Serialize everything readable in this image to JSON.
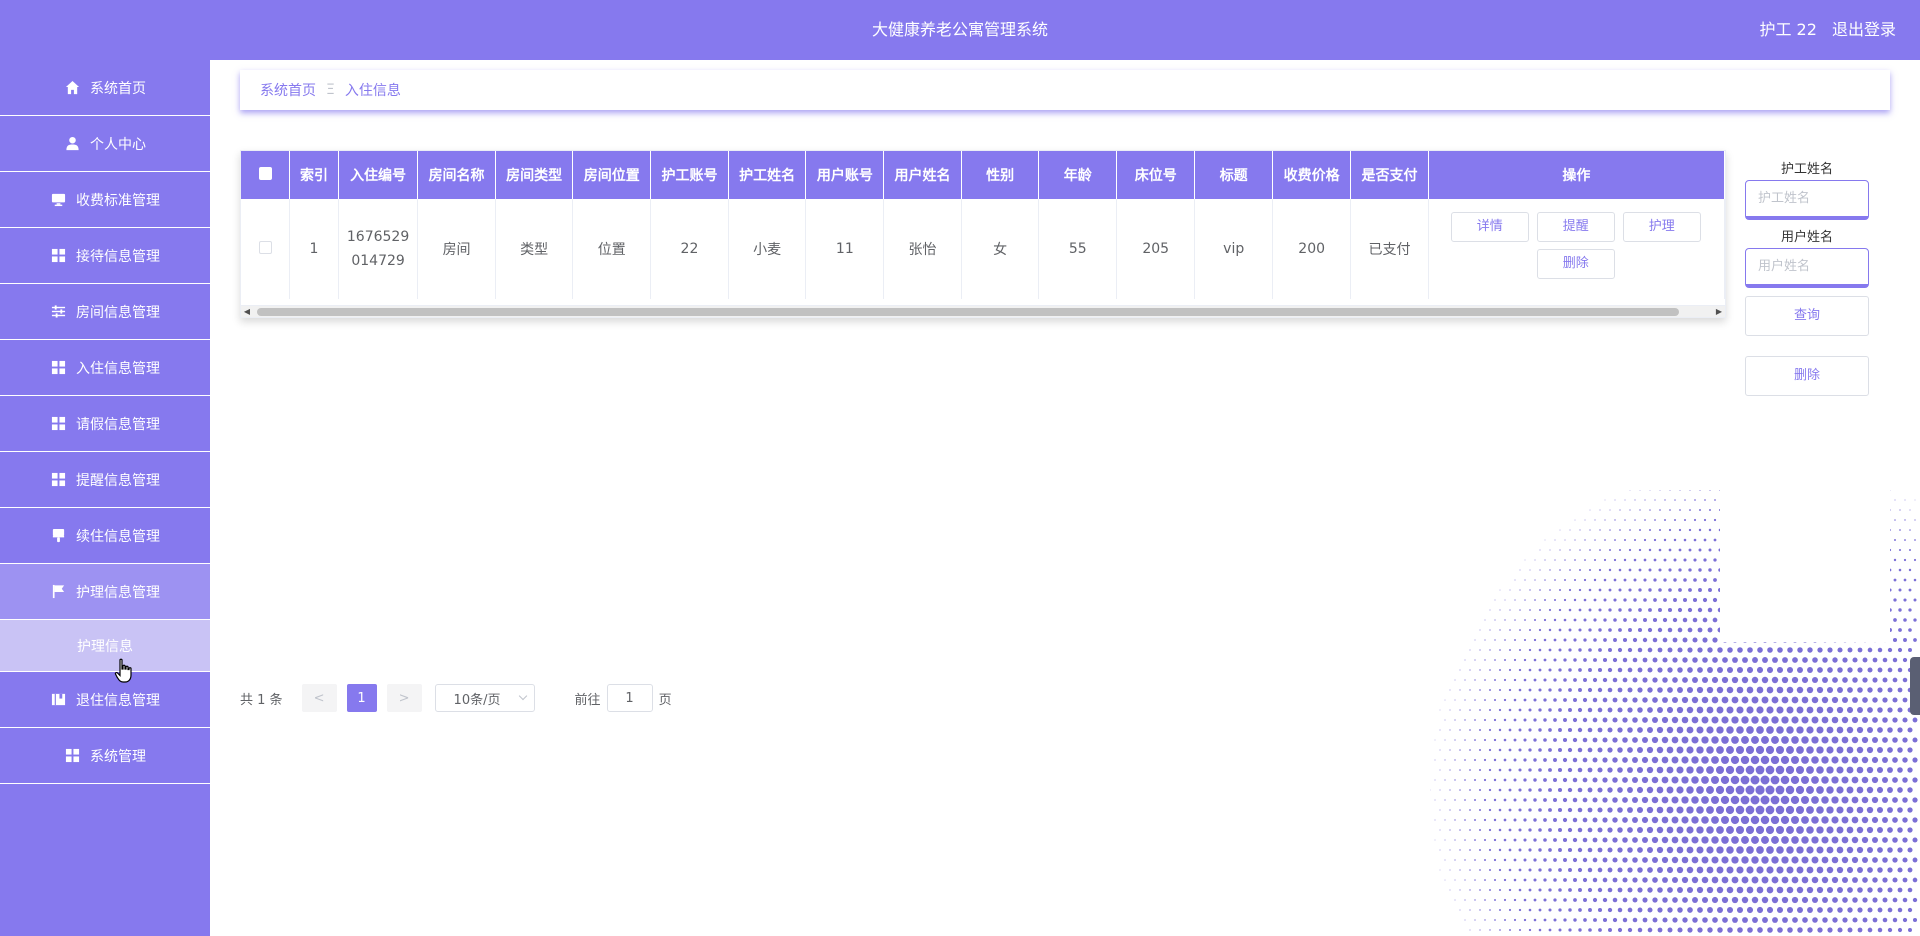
{
  "header": {
    "title": "大健康养老公寓管理系统",
    "user_label": "护工 22",
    "logout_label": "退出登录"
  },
  "sidebar": {
    "items": [
      {
        "label": "系统首页",
        "icon": "home-icon"
      },
      {
        "label": "个人中心",
        "icon": "user-icon"
      },
      {
        "label": "收费标准管理",
        "icon": "monitor-icon"
      },
      {
        "label": "接待信息管理",
        "icon": "grid-icon"
      },
      {
        "label": "房间信息管理",
        "icon": "sliders-icon"
      },
      {
        "label": "入住信息管理",
        "icon": "grid-icon"
      },
      {
        "label": "请假信息管理",
        "icon": "grid-icon"
      },
      {
        "label": "提醒信息管理",
        "icon": "grid-icon"
      },
      {
        "label": "续住信息管理",
        "icon": "brush-icon"
      },
      {
        "label": "护理信息管理",
        "icon": "flag-icon"
      }
    ],
    "submenu_label": "护理信息",
    "bottom_items": [
      {
        "label": "退住信息管理",
        "icon": "book-icon"
      },
      {
        "label": "系统管理",
        "icon": "grid-icon"
      }
    ]
  },
  "breadcrumb": {
    "home": "系统首页",
    "separator": "Ξ",
    "current": "入住信息"
  },
  "table": {
    "columns": [
      "索引",
      "入住编号",
      "房间名称",
      "房间类型",
      "房间位置",
      "护工账号",
      "护工姓名",
      "用户账号",
      "用户姓名",
      "性别",
      "年龄",
      "床位号",
      "标题",
      "收费价格",
      "是否支付",
      "操作"
    ],
    "rows": [
      {
        "index": "1",
        "checkin_no_line1": "1676529",
        "checkin_no_line2": "014729",
        "room_name": "房间",
        "room_type": "类型",
        "room_location": "位置",
        "nurse_account": "22",
        "nurse_name": "小麦",
        "user_account": "11",
        "user_name": "张怡",
        "gender": "女",
        "age": "55",
        "bed_no": "205",
        "title": "vip",
        "price": "200",
        "paid": "已支付"
      }
    ],
    "actions": [
      "详情",
      "提醒",
      "护理",
      "删除"
    ]
  },
  "search": {
    "nurse_label": "护工姓名",
    "nurse_placeholder": "护工姓名",
    "user_label": "用户姓名",
    "user_placeholder": "用户姓名",
    "query_label": "查询",
    "delete_label": "删除"
  },
  "pagination": {
    "total_text": "共 1 条",
    "prev": "<",
    "current_page": "1",
    "next": ">",
    "page_size": "10条/页",
    "goto_prefix": "前往",
    "goto_value": "1",
    "goto_suffix": "页"
  },
  "colors": {
    "primary": "#8679ee",
    "sidebar_active": "#9d92f2",
    "submenu": "#c9c3f5"
  }
}
